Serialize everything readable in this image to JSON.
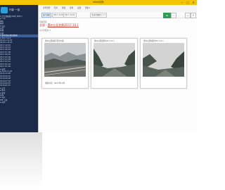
{
  "window": {
    "title": "Walk切换",
    "controls": [
      "—",
      "□",
      "✕"
    ]
  },
  "sidebar": {
    "logo_text": "行影 一站",
    "tree": [
      {
        "label": "▾ 乐行线路数(14种) 8/9(1)",
        "sel": false
      },
      {
        "label": "  ▸ 广州",
        "sel": false
      },
      {
        "label": "   城区",
        "sel": false
      },
      {
        "label": "   番禺",
        "sel": false
      },
      {
        "label": "  ▾ 白云",
        "sel": false
      },
      {
        "label": "   从化",
        "sel": false
      },
      {
        "label": "   增城",
        "sel": false
      },
      {
        "label": "   花都",
        "sel": false
      },
      {
        "label": "  ▾ 惠州(惠东惠阳惠城)",
        "sel": true
      },
      {
        "label": "   ▾ 2017-12-2",
        "sel": false
      },
      {
        "label": "     2018-1-12-01",
        "sel": false
      },
      {
        "label": "     2018-1-15-01",
        "sel": false
      },
      {
        "label": "     2017-10-01",
        "sel": false
      },
      {
        "label": "     2017-09-03",
        "sel": false
      },
      {
        "label": "     2017-08-05",
        "sel": false
      },
      {
        "label": "     2017-07-08",
        "sel": false
      },
      {
        "label": "     2017-06-02",
        "sel": false
      },
      {
        "label": "     2017-05-06",
        "sel": false
      },
      {
        "label": "     2017-04-08",
        "sel": false
      },
      {
        "label": "     2017-03-01",
        "sel": false
      },
      {
        "label": "     2017-02-04",
        "sel": false
      },
      {
        "label": "     2017-01-06",
        "sel": false
      },
      {
        "label": "  ▸ 深圳",
        "sel": false
      },
      {
        "label": "   ▸ 2016-11-02",
        "sel": false
      },
      {
        "label": "     2016-10-08",
        "sel": false
      },
      {
        "label": "     2016-09-01",
        "sel": false
      },
      {
        "label": "     2016-08-06",
        "sel": false
      },
      {
        "label": "     2016-07-02",
        "sel": false
      },
      {
        "label": "     2016-06-03",
        "sel": false
      },
      {
        "label": "     2016-05-07",
        "sel": false
      },
      {
        "label": "  ▸ 东莞",
        "sel": false
      },
      {
        "label": "  ▸ 佛山",
        "sel": false
      },
      {
        "label": "   ▸ 顺德",
        "sel": false
      },
      {
        "label": "     南海",
        "sel": false
      },
      {
        "label": "   ▸ 清远",
        "sel": false
      },
      {
        "label": "     PDF下载",
        "sel": false
      },
      {
        "label": "   ▸ 其他",
        "sel": false
      }
    ]
  },
  "toolbar": {
    "menu": [
      "文件管理",
      "照片",
      "视频",
      "其他",
      "设置",
      "帮助 ▾"
    ]
  },
  "tabs": {
    "items": [
      "照片视图",
      "2017-10-01",
      "2017-10-02",
      "活动行摄照片 1 ✕"
    ],
    "buttons": [
      "⊞",
      "✓",
      "◳",
      "☰"
    ]
  },
  "content": {
    "crumb_small": "当前目录：",
    "crumb_root": "全部",
    "crumb_sep": "›",
    "crumb_current": "惠州山区拍照2017.10.1",
    "count": "(共3张照片) ▾",
    "cards": [
      {
        "title": "惠州山区拍照 雨中公路",
        "caption": "拍照时间：2017年10月"
      },
      {
        "title": "惠州山区拍照2017.10.1",
        "caption": ""
      },
      {
        "title": "惠州山区拍照2017.10.1",
        "caption": ""
      }
    ]
  }
}
